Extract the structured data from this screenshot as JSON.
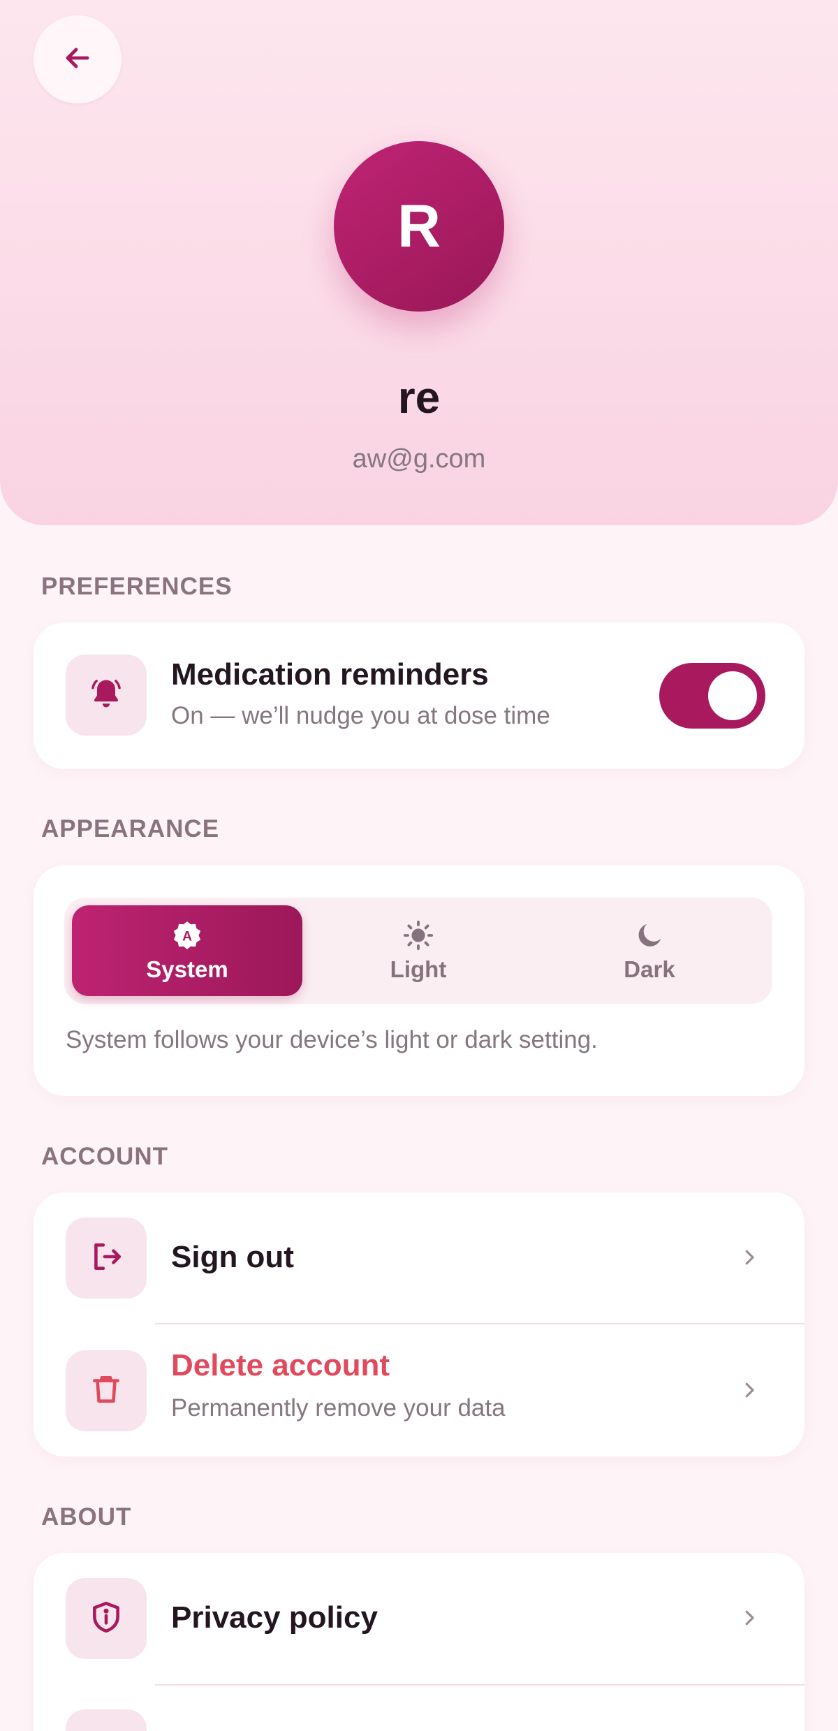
{
  "profile": {
    "avatar_initial": "R",
    "name": "re",
    "email": "aw@g.com"
  },
  "preferences": {
    "section_label": "PREFERENCES",
    "reminders": {
      "title": "Medication reminders",
      "subtitle": "On — we’ll nudge you at dose time",
      "enabled": true
    }
  },
  "appearance": {
    "section_label": "APPEARANCE",
    "options": [
      {
        "label": "System",
        "icon": "auto-theme-icon",
        "selected": true
      },
      {
        "label": "Light",
        "icon": "sun-icon",
        "selected": false
      },
      {
        "label": "Dark",
        "icon": "moon-icon",
        "selected": false
      }
    ],
    "note": "System follows your device’s light or dark setting."
  },
  "account": {
    "section_label": "ACCOUNT",
    "sign_out": {
      "title": "Sign out",
      "icon": "sign-out-icon"
    },
    "delete": {
      "title": "Delete account",
      "subtitle": "Permanently remove your data",
      "icon": "trash-icon"
    }
  },
  "about": {
    "section_label": "ABOUT",
    "privacy": {
      "title": "Privacy policy",
      "icon": "shield-info-icon"
    }
  },
  "colors": {
    "accent": "#a8195e",
    "danger": "#e04a5c",
    "header_bg": "#fbdbe8",
    "page_bg": "#fef4f7"
  }
}
